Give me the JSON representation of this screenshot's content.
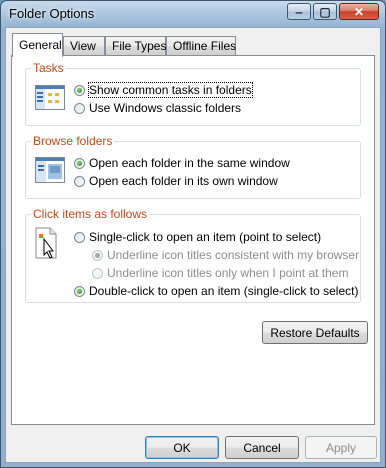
{
  "window": {
    "title": "Folder Options"
  },
  "titlebar": {
    "min_glyph": "‒",
    "max_glyph": "▢",
    "close_glyph": "✕"
  },
  "tabs": [
    {
      "label": "General",
      "active": true
    },
    {
      "label": "View",
      "active": false
    },
    {
      "label": "File Types",
      "active": false
    },
    {
      "label": "Offline Files",
      "active": false
    }
  ],
  "tasks": {
    "title": "Tasks",
    "options": [
      {
        "label": "Show common tasks in folders",
        "checked": true
      },
      {
        "label": "Use Windows classic folders",
        "checked": false
      }
    ]
  },
  "browse": {
    "title": "Browse folders",
    "options": [
      {
        "label": "Open each folder in the same window",
        "checked": true
      },
      {
        "label": "Open each folder in its own window",
        "checked": false
      }
    ]
  },
  "click": {
    "title": "Click items as follows",
    "options": [
      {
        "label": "Single-click to open an item (point to select)",
        "checked": false
      },
      {
        "label": "Underline icon titles consistent with my browser",
        "checked": true,
        "disabled": true
      },
      {
        "label": "Underline icon titles only when I point at them",
        "checked": false,
        "disabled": true
      },
      {
        "label": "Double-click to open an item (single-click to select)",
        "checked": true
      }
    ]
  },
  "buttons": {
    "restore": "Restore Defaults",
    "ok": "OK",
    "cancel": "Cancel",
    "apply": "Apply"
  },
  "colors": {
    "group_title": "#c04a1a",
    "titlebar": "#93b3d2",
    "radio_selected": "#1a7a12"
  },
  "icons": {
    "tasks": "folder-tasks-preview-icon",
    "browse": "folder-window-preview-icon",
    "click": "click-cursor-icon"
  }
}
